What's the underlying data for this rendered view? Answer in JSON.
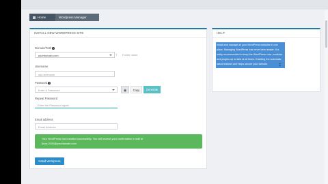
{
  "breadcrumb": [
    "Home",
    "Wordpress Manager"
  ],
  "form": {
    "title": "INSTALL NEW WORDPRESS SITE",
    "domain_label": "Domain/Path",
    "domain_value": "yourdomain.com",
    "path_placeholder": "Folder name",
    "username_label": "Username",
    "username_value": "wp-username",
    "password_label": "Password",
    "password_placeholder": "Enter A Password",
    "copy_label": "Copy",
    "generate_label": "Generate",
    "repeat_label": "Repeat Password",
    "repeat_placeholder": "Enter the Password again",
    "email_label": "Email address",
    "email_placeholder": "Email Address",
    "alert_line1": "Your WordPress has installed successfully. You will receive your confirmation e-mail at",
    "alert_line2": "[how-2020@yourdomain.com",
    "install_label": "Install Wordpress"
  },
  "help": {
    "title": "HELP",
    "lines": [
      "Install and manage all your WordPress websites in one",
      "place. Managing WordPress has never been easier. It is",
      "really recommended to keep the WordPress core, modules",
      "and plugins up to date at all times. Enabling the automatic",
      "latest features and helps secure your website."
    ]
  },
  "colors": {
    "accent": "#1f7ba0",
    "success": "#5cb85c",
    "primary_button": "#2b8ccb",
    "generate_button": "#5bc0c6",
    "selection": "#4a8fd6"
  }
}
